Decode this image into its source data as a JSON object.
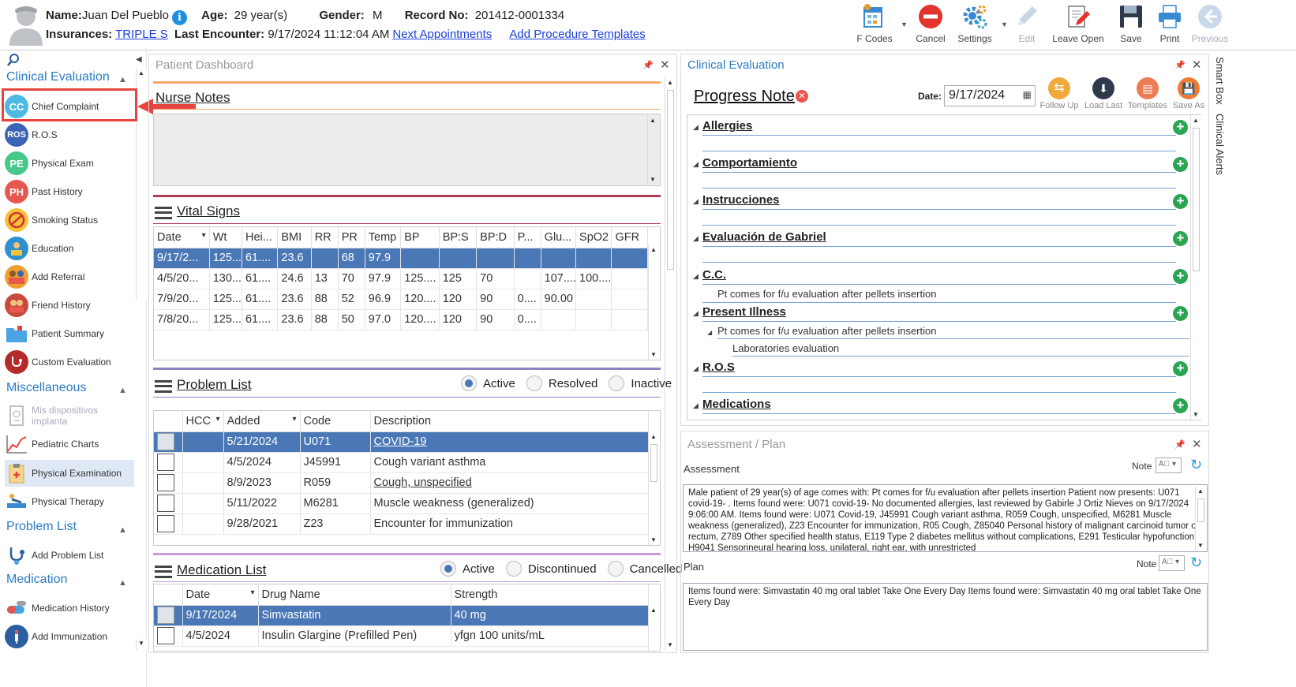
{
  "header": {
    "name_label": "Name:",
    "name_value": "Juan Del Pueblo",
    "age_label": "Age:",
    "age_value": "29 year(s)",
    "gender_label": "Gender:",
    "gender_value": "M",
    "record_label": "Record No:",
    "record_value": "201412-0001334",
    "insurances_label": "Insurances:",
    "insurances_value": "TRIPLE S",
    "last_encounter_label": "Last Encounter:",
    "last_encounter_value": "9/17/2024 11:12:04 AM",
    "next_appointments": "Next Appointments",
    "add_procedure_templates": "Add Procedure Templates"
  },
  "toolbar": {
    "fcodes": "F Codes",
    "cancel": "Cancel",
    "settings": "Settings",
    "edit": "Edit",
    "leave_open": "Leave Open",
    "save": "Save",
    "print": "Print",
    "previous": "Previous"
  },
  "sidebar": {
    "sections": {
      "clinical": "Clinical Evaluation",
      "misc": "Miscellaneous",
      "problem": "Problem List",
      "medication": "Medication"
    },
    "items": {
      "chief_complaint": "Chief Complaint",
      "ros": "R.O.S",
      "physical_exam": "Physical Exam",
      "past_history": "Past History",
      "smoking_status": "Smoking Status",
      "education": "Education",
      "add_referral": "Add Referral",
      "friend_history": "Friend History",
      "patient_summary": "Patient Summary",
      "custom_evaluation": "Custom Evaluation",
      "mis_dispositivos": "Mis dispositivos implanta",
      "pediatric_charts": "Pediatric Charts",
      "physical_examination": "Physical Examination",
      "physical_therapy": "Physical Therapy",
      "add_problem_list": "Add Problem List",
      "medication_history": "Medication History",
      "add_immunization": "Add Immunization"
    },
    "icons": {
      "cc": "CC",
      "ros": "ROS",
      "pe": "PE",
      "ph": "PH"
    }
  },
  "dashboard": {
    "title": "Patient Dashboard",
    "nurse_notes": "Nurse Notes",
    "vital_signs": "Vital Signs",
    "vitals_headers": [
      "Date",
      "Wt",
      "Hei...",
      "BMI",
      "RR",
      "PR",
      "Temp",
      "BP",
      "BP:S",
      "BP:D",
      "P...",
      "Glu...",
      "SpO2",
      "GFR"
    ],
    "vitals_rows": [
      [
        "9/17/2...",
        "125....",
        "61....",
        "23.6",
        "",
        "68",
        "97.9",
        "",
        "",
        "",
        "",
        "",
        "",
        ""
      ],
      [
        "4/5/20...",
        "130....",
        "61....",
        "24.6",
        "13",
        "70",
        "97.9",
        "125....",
        "125",
        "70",
        "",
        "107....",
        "100....",
        ""
      ],
      [
        "7/9/20...",
        "125....",
        "61....",
        "23.6",
        "88",
        "52",
        "96.9",
        "120....",
        "120",
        "90",
        "0....",
        "90.00",
        "",
        ""
      ],
      [
        "7/8/20...",
        "125....",
        "61....",
        "23.6",
        "88",
        "50",
        "97.0",
        "120....",
        "120",
        "90",
        "0....",
        "",
        "",
        ""
      ]
    ],
    "problem_list": "Problem List",
    "problem_filters": [
      "Active",
      "Resolved",
      "Inactive"
    ],
    "problem_headers": [
      "",
      "HCC",
      "Added",
      "Code",
      "Description"
    ],
    "problem_rows": [
      [
        "",
        "",
        "5/21/2024",
        "U071",
        "COVID-19"
      ],
      [
        "",
        "",
        "4/5/2024",
        "J45991",
        "Cough variant asthma"
      ],
      [
        "",
        "",
        "8/9/2023",
        "R059",
        "Cough, unspecified"
      ],
      [
        "",
        "",
        "5/11/2022",
        "M6281",
        "Muscle weakness (generalized)"
      ],
      [
        "",
        "",
        "9/28/2021",
        "Z23",
        "Encounter for immunization"
      ]
    ],
    "medication_list": "Medication List",
    "medication_filters": [
      "Active",
      "Discontinued",
      "Cancelled"
    ],
    "medication_headers": [
      "",
      "Date",
      "Drug Name",
      "Strength"
    ],
    "medication_rows": [
      [
        "",
        "9/17/2024",
        "Simvastatin",
        "40 mg"
      ],
      [
        "",
        "4/5/2024",
        "Insulin Glargine (Prefilled Pen)",
        "yfgn 100 units/mL"
      ]
    ]
  },
  "clinical": {
    "title": "Clinical Evaluation",
    "progress_note": "Progress Note",
    "date_label": "Date:",
    "date_value": "9/17/2024",
    "actions": [
      "Follow Up",
      "Load Last",
      "Templates",
      "Save As"
    ],
    "sections": {
      "allergies": "Allergies",
      "comportamiento": "Comportamiento",
      "instrucciones": "Instrucciones",
      "evaluacion": "Evaluación de Gabriel",
      "cc": "C.C.",
      "present_illness": "Present Illness",
      "ros": "R.O.S",
      "medications": "Medications"
    },
    "cc_text": "Pt comes for f/u evaluation after pellets insertion",
    "pi_text": "Pt comes for f/u evaluation after pellets insertion",
    "pi_sub": "Laboratories evaluation"
  },
  "side_tabs": {
    "smart_box": "Smart Box",
    "clinical_alerts": "Clinical Alerts"
  },
  "assessment": {
    "title": "Assessment / Plan",
    "assessment_label": "Assessment",
    "note_label": "Note",
    "assessment_text": "Male patient of 29 year(s) of age comes with:  Pt comes for f/u evaluation after pellets insertion  Patient now presents: U071 covid-19- . Items found were:  U071 covid-19-    No documented allergies, last reviewed by Gabirle J Ortiz Nieves on 9/17/2024 9:06:00 AM.     Items found were:  U071 Covid-19, J45991 Cough variant asthma, R059 Cough, unspecified, M6281 Muscle weakness (generalized), Z23 Encounter for immunization, R05 Cough, Z85040 Personal history of malignant carcinoid tumor of rectum, Z789 Other specified health status, E119 Type 2 diabetes mellitus without complications, E291 Testicular hypofunction, H9041 Sensorineural hearing loss, unilateral, right ear, with unrestricted",
    "plan_label": "Plan",
    "plan_text": "  Items found were:  Simvastatin 40 mg oral tablet Take One Every Day   Items found were:  Simvastatin 40 mg oral tablet Take One Every Day"
  }
}
